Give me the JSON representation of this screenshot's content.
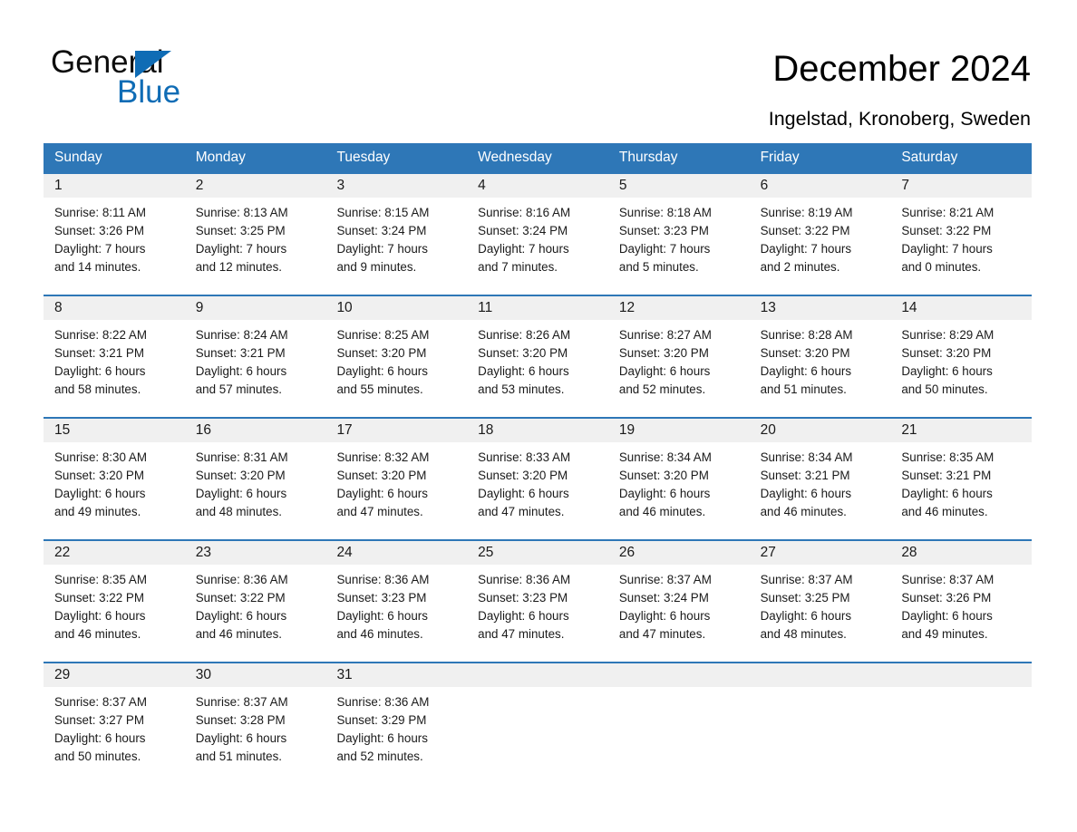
{
  "brand": {
    "name_part1": "General",
    "name_part2": "Blue",
    "triangle_color": "#0f6cb5",
    "accent_color": "#2e77b7"
  },
  "header": {
    "title": "December 2024",
    "location": "Ingelstad, Kronoberg, Sweden"
  },
  "calendar": {
    "weekday_headers": [
      "Sunday",
      "Monday",
      "Tuesday",
      "Wednesday",
      "Thursday",
      "Friday",
      "Saturday"
    ],
    "header_bg": "#2e77b7",
    "daynum_bg": "#f0f0f0",
    "weeks": [
      {
        "numbers": [
          "1",
          "2",
          "3",
          "4",
          "5",
          "6",
          "7"
        ],
        "cells": [
          {
            "sunrise": "Sunrise: 8:11 AM",
            "sunset": "Sunset: 3:26 PM",
            "daylight1": "Daylight: 7 hours",
            "daylight2": "and 14 minutes."
          },
          {
            "sunrise": "Sunrise: 8:13 AM",
            "sunset": "Sunset: 3:25 PM",
            "daylight1": "Daylight: 7 hours",
            "daylight2": "and 12 minutes."
          },
          {
            "sunrise": "Sunrise: 8:15 AM",
            "sunset": "Sunset: 3:24 PM",
            "daylight1": "Daylight: 7 hours",
            "daylight2": "and 9 minutes."
          },
          {
            "sunrise": "Sunrise: 8:16 AM",
            "sunset": "Sunset: 3:24 PM",
            "daylight1": "Daylight: 7 hours",
            "daylight2": "and 7 minutes."
          },
          {
            "sunrise": "Sunrise: 8:18 AM",
            "sunset": "Sunset: 3:23 PM",
            "daylight1": "Daylight: 7 hours",
            "daylight2": "and 5 minutes."
          },
          {
            "sunrise": "Sunrise: 8:19 AM",
            "sunset": "Sunset: 3:22 PM",
            "daylight1": "Daylight: 7 hours",
            "daylight2": "and 2 minutes."
          },
          {
            "sunrise": "Sunrise: 8:21 AM",
            "sunset": "Sunset: 3:22 PM",
            "daylight1": "Daylight: 7 hours",
            "daylight2": "and 0 minutes."
          }
        ]
      },
      {
        "numbers": [
          "8",
          "9",
          "10",
          "11",
          "12",
          "13",
          "14"
        ],
        "cells": [
          {
            "sunrise": "Sunrise: 8:22 AM",
            "sunset": "Sunset: 3:21 PM",
            "daylight1": "Daylight: 6 hours",
            "daylight2": "and 58 minutes."
          },
          {
            "sunrise": "Sunrise: 8:24 AM",
            "sunset": "Sunset: 3:21 PM",
            "daylight1": "Daylight: 6 hours",
            "daylight2": "and 57 minutes."
          },
          {
            "sunrise": "Sunrise: 8:25 AM",
            "sunset": "Sunset: 3:20 PM",
            "daylight1": "Daylight: 6 hours",
            "daylight2": "and 55 minutes."
          },
          {
            "sunrise": "Sunrise: 8:26 AM",
            "sunset": "Sunset: 3:20 PM",
            "daylight1": "Daylight: 6 hours",
            "daylight2": "and 53 minutes."
          },
          {
            "sunrise": "Sunrise: 8:27 AM",
            "sunset": "Sunset: 3:20 PM",
            "daylight1": "Daylight: 6 hours",
            "daylight2": "and 52 minutes."
          },
          {
            "sunrise": "Sunrise: 8:28 AM",
            "sunset": "Sunset: 3:20 PM",
            "daylight1": "Daylight: 6 hours",
            "daylight2": "and 51 minutes."
          },
          {
            "sunrise": "Sunrise: 8:29 AM",
            "sunset": "Sunset: 3:20 PM",
            "daylight1": "Daylight: 6 hours",
            "daylight2": "and 50 minutes."
          }
        ]
      },
      {
        "numbers": [
          "15",
          "16",
          "17",
          "18",
          "19",
          "20",
          "21"
        ],
        "cells": [
          {
            "sunrise": "Sunrise: 8:30 AM",
            "sunset": "Sunset: 3:20 PM",
            "daylight1": "Daylight: 6 hours",
            "daylight2": "and 49 minutes."
          },
          {
            "sunrise": "Sunrise: 8:31 AM",
            "sunset": "Sunset: 3:20 PM",
            "daylight1": "Daylight: 6 hours",
            "daylight2": "and 48 minutes."
          },
          {
            "sunrise": "Sunrise: 8:32 AM",
            "sunset": "Sunset: 3:20 PM",
            "daylight1": "Daylight: 6 hours",
            "daylight2": "and 47 minutes."
          },
          {
            "sunrise": "Sunrise: 8:33 AM",
            "sunset": "Sunset: 3:20 PM",
            "daylight1": "Daylight: 6 hours",
            "daylight2": "and 47 minutes."
          },
          {
            "sunrise": "Sunrise: 8:34 AM",
            "sunset": "Sunset: 3:20 PM",
            "daylight1": "Daylight: 6 hours",
            "daylight2": "and 46 minutes."
          },
          {
            "sunrise": "Sunrise: 8:34 AM",
            "sunset": "Sunset: 3:21 PM",
            "daylight1": "Daylight: 6 hours",
            "daylight2": "and 46 minutes."
          },
          {
            "sunrise": "Sunrise: 8:35 AM",
            "sunset": "Sunset: 3:21 PM",
            "daylight1": "Daylight: 6 hours",
            "daylight2": "and 46 minutes."
          }
        ]
      },
      {
        "numbers": [
          "22",
          "23",
          "24",
          "25",
          "26",
          "27",
          "28"
        ],
        "cells": [
          {
            "sunrise": "Sunrise: 8:35 AM",
            "sunset": "Sunset: 3:22 PM",
            "daylight1": "Daylight: 6 hours",
            "daylight2": "and 46 minutes."
          },
          {
            "sunrise": "Sunrise: 8:36 AM",
            "sunset": "Sunset: 3:22 PM",
            "daylight1": "Daylight: 6 hours",
            "daylight2": "and 46 minutes."
          },
          {
            "sunrise": "Sunrise: 8:36 AM",
            "sunset": "Sunset: 3:23 PM",
            "daylight1": "Daylight: 6 hours",
            "daylight2": "and 46 minutes."
          },
          {
            "sunrise": "Sunrise: 8:36 AM",
            "sunset": "Sunset: 3:23 PM",
            "daylight1": "Daylight: 6 hours",
            "daylight2": "and 47 minutes."
          },
          {
            "sunrise": "Sunrise: 8:37 AM",
            "sunset": "Sunset: 3:24 PM",
            "daylight1": "Daylight: 6 hours",
            "daylight2": "and 47 minutes."
          },
          {
            "sunrise": "Sunrise: 8:37 AM",
            "sunset": "Sunset: 3:25 PM",
            "daylight1": "Daylight: 6 hours",
            "daylight2": "and 48 minutes."
          },
          {
            "sunrise": "Sunrise: 8:37 AM",
            "sunset": "Sunset: 3:26 PM",
            "daylight1": "Daylight: 6 hours",
            "daylight2": "and 49 minutes."
          }
        ]
      },
      {
        "numbers": [
          "29",
          "30",
          "31",
          "",
          "",
          "",
          ""
        ],
        "cells": [
          {
            "sunrise": "Sunrise: 8:37 AM",
            "sunset": "Sunset: 3:27 PM",
            "daylight1": "Daylight: 6 hours",
            "daylight2": "and 50 minutes."
          },
          {
            "sunrise": "Sunrise: 8:37 AM",
            "sunset": "Sunset: 3:28 PM",
            "daylight1": "Daylight: 6 hours",
            "daylight2": "and 51 minutes."
          },
          {
            "sunrise": "Sunrise: 8:36 AM",
            "sunset": "Sunset: 3:29 PM",
            "daylight1": "Daylight: 6 hours",
            "daylight2": "and 52 minutes."
          },
          {
            "sunrise": "",
            "sunset": "",
            "daylight1": "",
            "daylight2": ""
          },
          {
            "sunrise": "",
            "sunset": "",
            "daylight1": "",
            "daylight2": ""
          },
          {
            "sunrise": "",
            "sunset": "",
            "daylight1": "",
            "daylight2": ""
          },
          {
            "sunrise": "",
            "sunset": "",
            "daylight1": "",
            "daylight2": ""
          }
        ]
      }
    ]
  }
}
